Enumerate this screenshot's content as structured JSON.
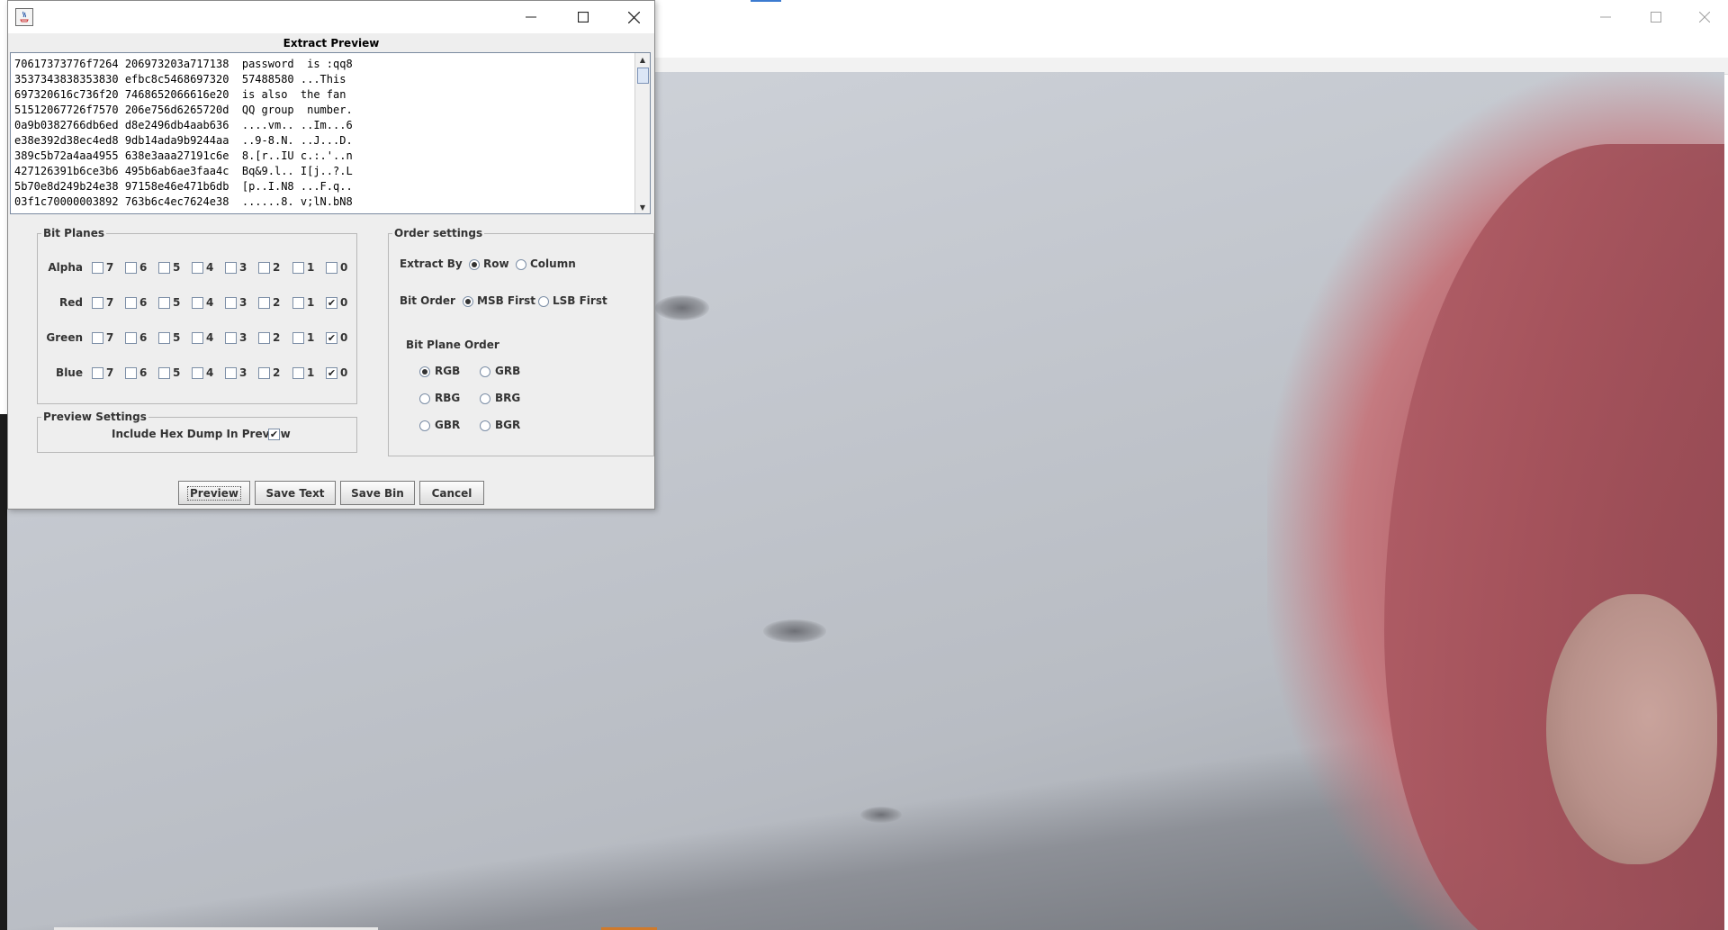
{
  "dialog": {
    "title_icon": "java-app-icon",
    "minimize_icon": "minimize-icon",
    "maximize_icon": "maximize-icon",
    "close_icon": "close-icon",
    "preview_title": "Extract Preview",
    "hex_lines": [
      "70617373776f7264 206973203a717138  password  is :qq8",
      "3537343838353830 efbc8c5468697320  57488580 ...This",
      "697320616c736f20 7468652066616e20  is also  the fan",
      "51512067726f7570 206e756d6265720d  QQ group  number.",
      "0a9b0382766db6ed d8e2496db4aab636  ....vm.. ..Im...6",
      "e38e392d38ec4ed8 9db14ada9b9244aa  ..9-8.N. ..J...D.",
      "389c5b72a4aa4955 638e3aaa27191c6e  8.[r..IU c.:.'..n",
      "427126391b6ce3b6 495b6ab6ae3faa4c  Bq&9.l.. I[j..?.L",
      "5b70e8d249b24e38 97158e46e471b6db  [p..I.N8 ...F.q..",
      "03f1c70000003892 763b6c4ec7624e38  ......8. v;lN.bN8"
    ],
    "bit_planes": {
      "title": "Bit Planes",
      "bits": [
        "7",
        "6",
        "5",
        "4",
        "3",
        "2",
        "1",
        "0"
      ],
      "channels": [
        {
          "name": "Alpha",
          "checked": [
            false,
            false,
            false,
            false,
            false,
            false,
            false,
            false
          ]
        },
        {
          "name": "Red",
          "checked": [
            false,
            false,
            false,
            false,
            false,
            false,
            false,
            true
          ]
        },
        {
          "name": "Green",
          "checked": [
            false,
            false,
            false,
            false,
            false,
            false,
            false,
            true
          ]
        },
        {
          "name": "Blue",
          "checked": [
            false,
            false,
            false,
            false,
            false,
            false,
            false,
            true
          ]
        }
      ]
    },
    "preview_settings": {
      "title": "Preview Settings",
      "hex_dump_label": "Include Hex Dump In Preview",
      "hex_dump_checked": true
    },
    "order_settings": {
      "title": "Order settings",
      "extract_by_label": "Extract By",
      "extract_by_options": [
        "Row",
        "Column"
      ],
      "extract_by_selected": "Row",
      "bit_order_label": "Bit Order",
      "bit_order_options": [
        "MSB First",
        "LSB First"
      ],
      "bit_order_selected": "MSB First",
      "bit_plane_order_label": "Bit Plane Order",
      "bit_plane_order_options": [
        "RGB",
        "GRB",
        "RBG",
        "BRG",
        "GBR",
        "BGR"
      ],
      "bit_plane_order_selected": "RGB"
    },
    "buttons": {
      "preview": "Preview",
      "save_text": "Save Text",
      "save_bin": "Save Bin",
      "cancel": "Cancel"
    }
  },
  "background_window": {
    "minimize_icon": "minimize-icon",
    "maximize_icon": "maximize-icon",
    "close_icon": "close-icon",
    "image": "photo of ceiling with pink-haired figure"
  }
}
